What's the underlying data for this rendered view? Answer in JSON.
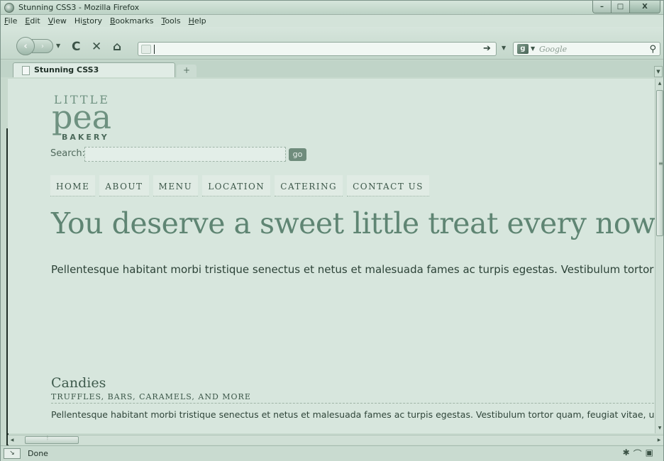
{
  "window": {
    "title": "Stunning CSS3 - Mozilla Firefox",
    "minimize": "–",
    "maximize": "□",
    "close": "X"
  },
  "menubar": {
    "items": [
      {
        "key": "F",
        "rest": "ile"
      },
      {
        "key": "E",
        "rest": "dit"
      },
      {
        "key": "V",
        "rest": "iew"
      },
      {
        "pre": "Hi",
        "key": "s",
        "rest": "tory"
      },
      {
        "key": "B",
        "rest": "ookmarks"
      },
      {
        "key": "T",
        "rest": "ools"
      },
      {
        "key": "H",
        "rest": "elp"
      }
    ]
  },
  "toolbar": {
    "url_value": "",
    "search_placeholder": "Google"
  },
  "tabs": [
    {
      "label": "Stunning CSS3"
    }
  ],
  "page": {
    "logo": {
      "little": "LITTLE",
      "pea": "pea",
      "bakery": "BAKERY"
    },
    "search_label": "Search:",
    "search_value": "",
    "go_label": "go",
    "nav": [
      "HOME",
      "ABOUT",
      "MENU",
      "LOCATION",
      "CATERING",
      "CONTACT US"
    ],
    "hero": "You deserve a sweet little treat every now and",
    "lead": "Pellentesque habitant morbi tristique senectus et netus et malesuada fames ac turpis egestas. Vestibulum tortor",
    "section": {
      "title": "Candies",
      "subtitle": "TRUFFLES, BARS, CARAMELS, AND MORE",
      "body": "Pellentesque habitant morbi tristique senectus et netus et malesuada fames ac turpis egestas. Vestibulum tortor quam, feugiat vitae, ult"
    }
  },
  "statusbar": {
    "text": "Done"
  }
}
